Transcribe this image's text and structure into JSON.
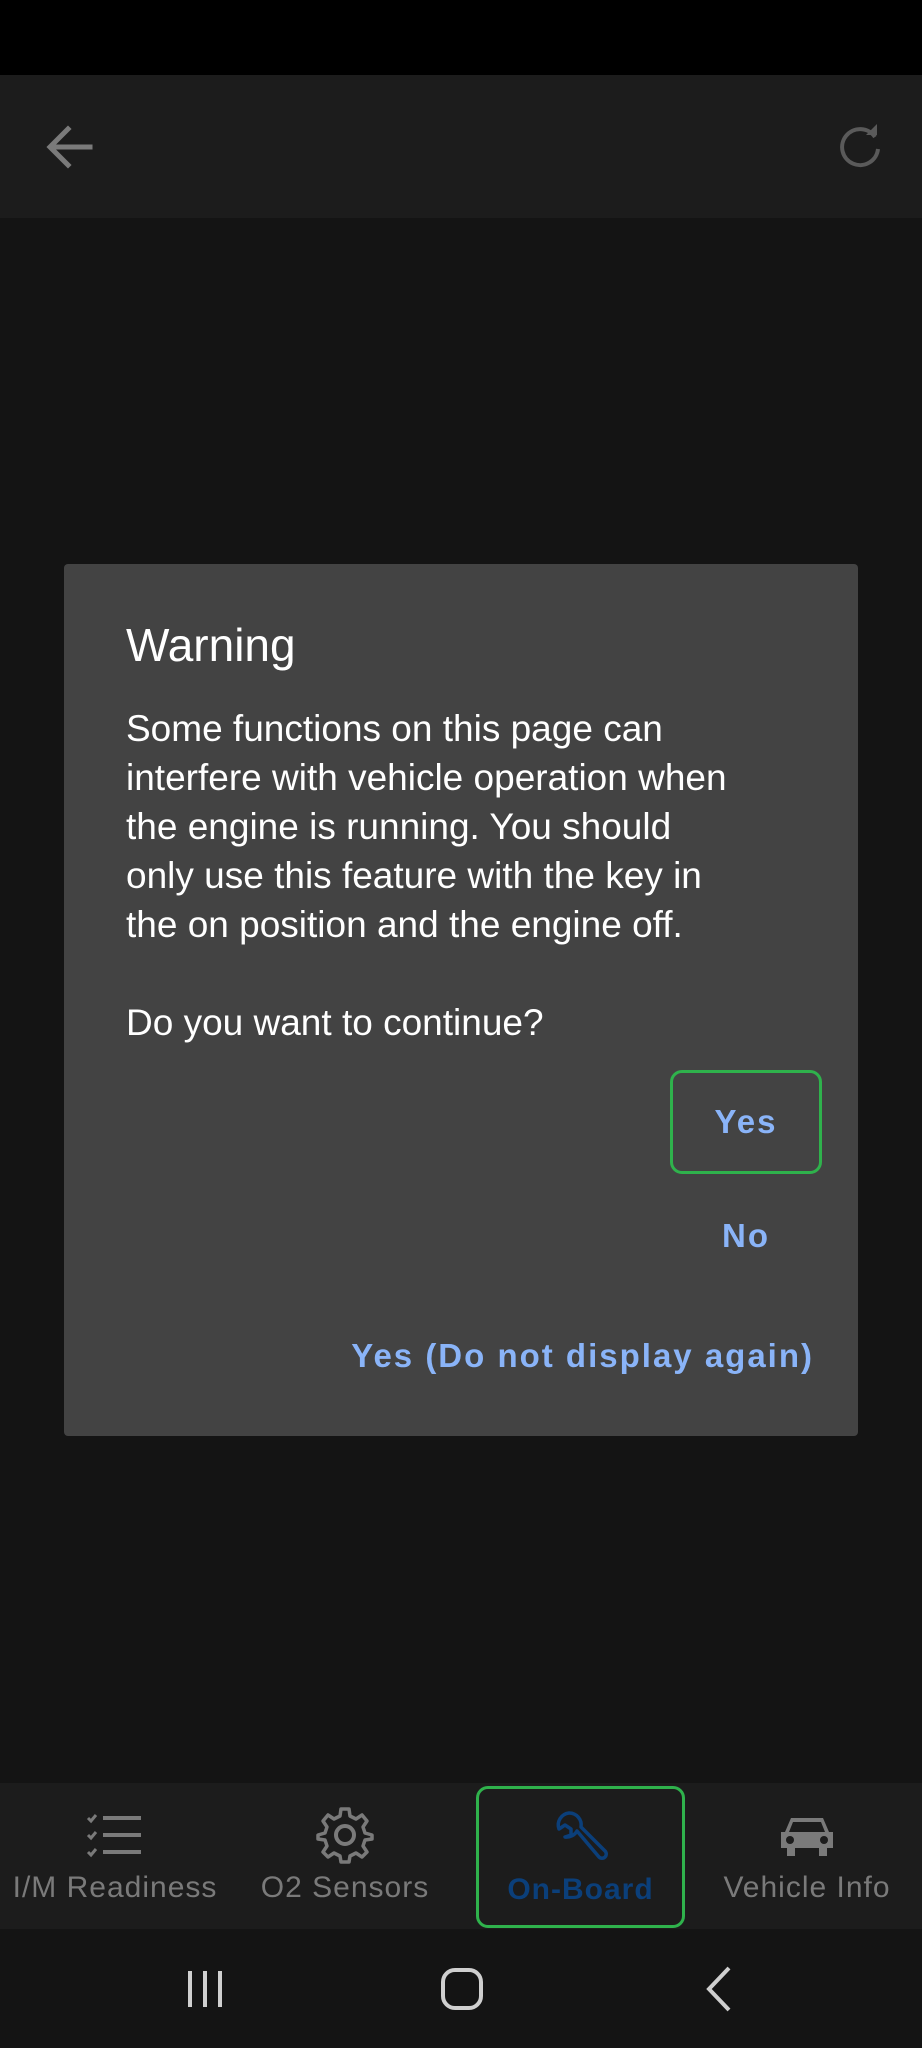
{
  "app_bar": {
    "back_icon": "arrow-left-icon",
    "refresh_icon": "refresh-icon"
  },
  "dialog": {
    "title": "Warning",
    "message": [
      "Some functions on this page can",
      "interfere with vehicle operation when",
      "the engine is running. You should",
      "only use this feature with the key in",
      "the on position and the engine off."
    ],
    "question": "Do you want to continue?",
    "buttons": {
      "yes": "Yes",
      "no": "No",
      "yes_do_not_display": "Yes (Do not display again)"
    }
  },
  "bottom_nav": {
    "items": [
      {
        "label": "I/M Readiness",
        "icon": "checklist-icon"
      },
      {
        "label": "O2 Sensors",
        "icon": "gear-icon"
      },
      {
        "label": "On-Board",
        "icon": "wrench-icon",
        "selected": true
      },
      {
        "label": "Vehicle Info",
        "icon": "car-icon"
      }
    ]
  },
  "system_nav": {
    "recents_icon": "recents-icon",
    "home_icon": "home-icon",
    "back_icon": "back-chevron-icon"
  },
  "colors": {
    "dialog_bg": "#434343",
    "button_text": "#8ab4f8",
    "focus_outline": "#2fb24c",
    "selected_label": "#0b3f7a"
  }
}
